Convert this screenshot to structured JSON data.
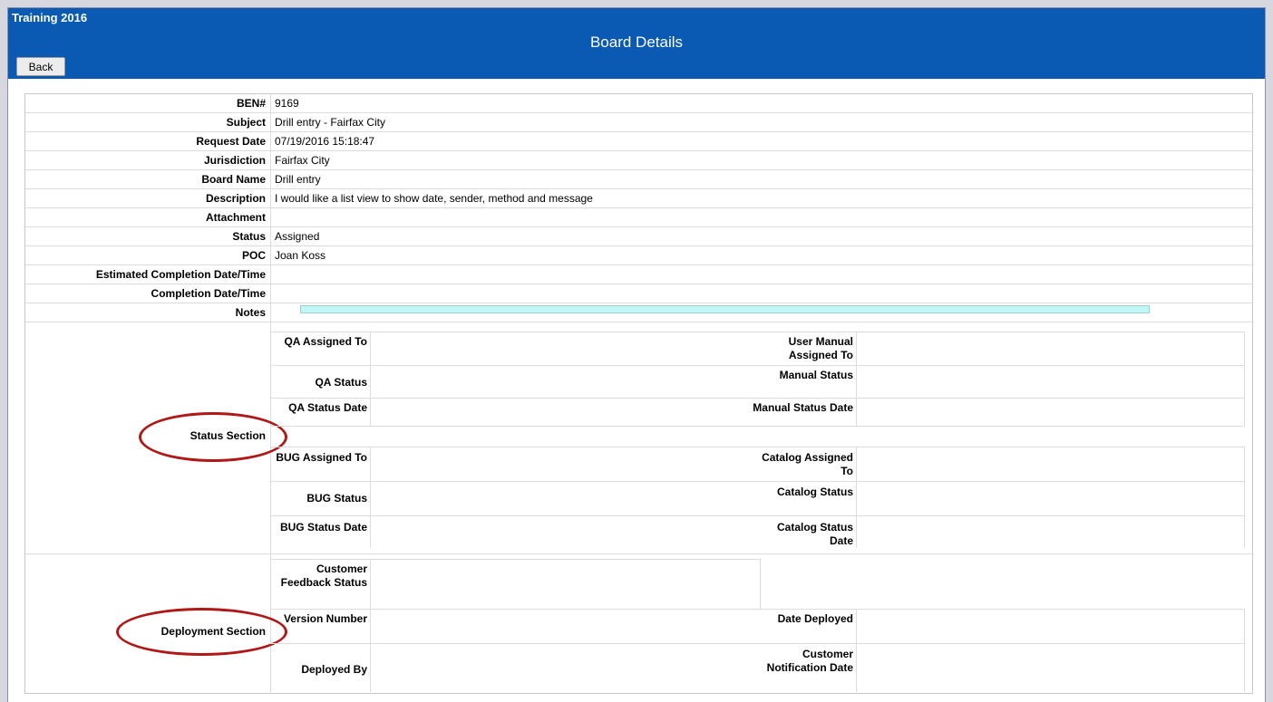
{
  "header": {
    "app_title": "Training 2016",
    "page_title": "Board Details",
    "back_label": "Back",
    "background_color": "#0a5ab4"
  },
  "fields": [
    {
      "label": "BEN#",
      "value": "9169"
    },
    {
      "label": "Subject",
      "value": "Drill entry - Fairfax City"
    },
    {
      "label": "Request Date",
      "value": "07/19/2016 15:18:47"
    },
    {
      "label": "Jurisdiction",
      "value": "Fairfax City"
    },
    {
      "label": "Board Name",
      "value": "Drill entry"
    },
    {
      "label": "Description",
      "value": "I would like a list view to show date, sender, method and message"
    },
    {
      "label": "Attachment",
      "value": ""
    },
    {
      "label": "Status",
      "value": "Assigned"
    },
    {
      "label": "POC",
      "value": "Joan Koss"
    },
    {
      "label": "Estimated Completion Date/Time",
      "value": ""
    },
    {
      "label": "Completion Date/Time",
      "value": ""
    },
    {
      "label": "Notes",
      "value": ""
    }
  ],
  "status_section": {
    "label": "Status Section",
    "qa_assigned_to": "QA Assigned To",
    "qa_status": "QA Status",
    "qa_status_date": "QA Status Date",
    "user_manual_assigned_to": "User Manual Assigned To",
    "manual_status": "Manual Status",
    "manual_status_date": "Manual Status Date",
    "bug_assigned_to": "BUG Assigned To",
    "bug_status": "BUG Status",
    "bug_status_date": "BUG Status Date",
    "catalog_assigned_to": "Catalog Assigned To",
    "catalog_status": "Catalog Status",
    "catalog_status_date": "Catalog Status Date"
  },
  "deployment_section": {
    "label": "Deployment Section",
    "customer_feedback_status": "Customer Feedback Status",
    "version_number": "Version Number",
    "date_deployed": "Date Deployed",
    "deployed_by": "Deployed By",
    "customer_notification_date": "Customer Notification Date"
  },
  "annotation_color": "#b01717"
}
